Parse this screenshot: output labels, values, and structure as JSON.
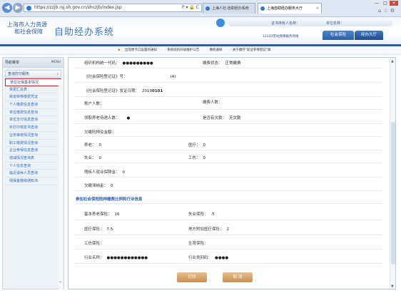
{
  "browser": {
    "url": "https://zzjb.rsj.sh.gov.cn/shczjb/index.jsp",
    "url_controls": "P ▾ 🔒 C",
    "tabs": [
      {
        "label": "上海人社-自助经办系统"
      },
      {
        "label": "上海自助经办服务大厅"
      }
    ],
    "window_buttons": [
      "—",
      "□",
      "✕"
    ]
  },
  "header": {
    "logo_line1": "上海市人力资源",
    "logo_line2": "和社会保障",
    "logo_title": "自助经办系统",
    "cert_label": "证书持有人名称：",
    "unit_label": "单位名称：",
    "hotline": "12333劳动保障服务热线",
    "nav": [
      {
        "label": "社会保险"
      },
      {
        "label": "经办大厅"
      }
    ]
  },
  "notice": {
    "items": [
      "出现更卡口设置的通知",
      "系统续机升级维护公告",
      "缴机通知",
      "关于缴存\"就业参保登记\"联"
    ]
  },
  "sidebar": {
    "head": "导航菜单",
    "menu_label": "MENU",
    "group": "查询打印服务",
    "items": [
      {
        "label": "单位社保基本情况",
        "active": true
      },
      {
        "label": "变更汇总表"
      },
      {
        "label": "跨省转移缴费凭证"
      },
      {
        "label": "个人缴费信息查询"
      },
      {
        "label": "单位缴费信息查询"
      },
      {
        "label": "单位支付信息查询"
      },
      {
        "label": "补打印核定书查询"
      },
      {
        "label": "业务审核情况查询"
      },
      {
        "label": "职工缴费情况查询"
      },
      {
        "label": "企业参保信息查询"
      },
      {
        "label": "增减情况查询表"
      },
      {
        "label": "个人信息查询"
      },
      {
        "label": "临近退休人员查询"
      },
      {
        "label": "残保金缴纳通知书"
      }
    ]
  },
  "form": {
    "org_code_label": "组织机构统一代码：",
    "org_code_value": "●●●●●●●●●",
    "pay_status_label": "缴费状态：",
    "pay_status_value": "正常缴费",
    "cert_no_label": "《社会保险登记证》号：",
    "cert_no_value": "(4)",
    "cert_date_label": "《社会保险登记证》发证日期：",
    "cert_date_value": "2019",
    "cert_date_masked": "0101",
    "account_label": "账户人数：",
    "account_right_label": "缴费人数：",
    "pension_people_label": "领取养老待遇人数：",
    "pension_people_value": "●",
    "owe_label": "是否有欠款：",
    "owe_value": "无欠款",
    "owe_amount_label": "欠缴险种及金额：",
    "pension_label": "养老：",
    "pension_value": "0",
    "medical_label": "医疗：",
    "medical_value": "0",
    "unemploy_label": "失业：",
    "unemploy_value": "0",
    "injury_label": "工伤：",
    "injury_value": "0",
    "disabled_label": "残疾人就业保障金：",
    "disabled_value": "0",
    "owe_penalty_label": "欠缴滞纳金：",
    "owe_penalty_value": "0",
    "rate_section": "参加社会保险险种缴费比例和行业信息",
    "basic_pension_label": "基本养老保险：",
    "basic_pension_value": "16",
    "unemploy_ins_label": "失业保险：",
    "unemploy_ins_value": ".5",
    "medical_ins_label": "医疗保险：",
    "medical_ins_value": "7.5",
    "local_medical_label": "地方附加医疗保险：",
    "local_medical_value": "2",
    "injury_ins_label": "工伤保险：",
    "maternity_label": "生育保险：",
    "industry_name_label": "行业名称：",
    "industry_name_value": "●●●●●●●●●●●●",
    "industry_cat_label": "行业类别码：",
    "industry_cat_value": "●●●●",
    "print_button": "打印",
    "cancel_button": "取 消"
  }
}
